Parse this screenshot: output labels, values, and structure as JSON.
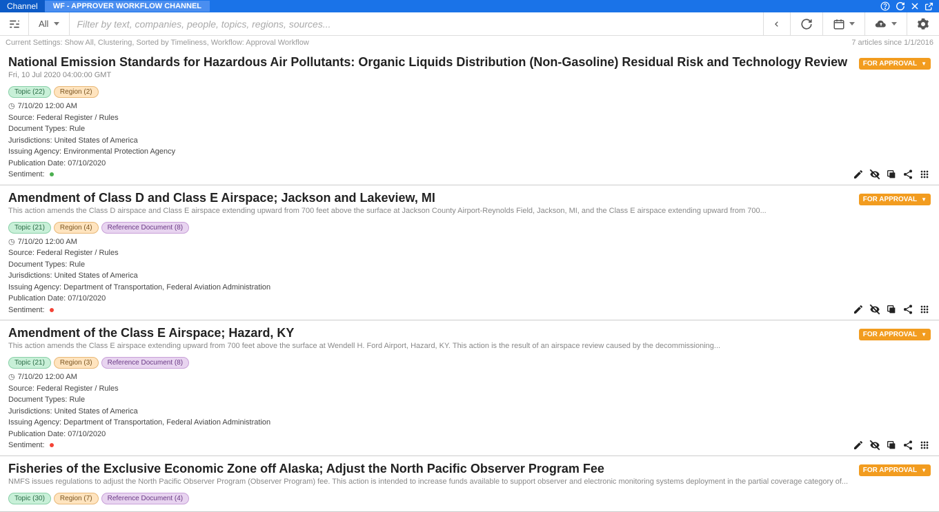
{
  "topbar": {
    "channel_label": "Channel",
    "channel_name": "WF - APPROVER WORKFLOW CHANNEL"
  },
  "filterbar": {
    "all_label": "All",
    "search_placeholder": "Filter by text, companies, people, topics, regions, sources..."
  },
  "settings_left": "Current Settings: Show All, Clustering, Sorted by Timeliness, Workflow: Approval Workflow",
  "settings_right": "7 articles since 1/1/2016",
  "approval_label": "FOR APPROVAL",
  "articles": [
    {
      "title": "National Emission Standards for Hazardous Air Pollutants: Organic Liquids Distribution (Non-Gasoline) Residual Risk and Technology Review",
      "sub": "Fri, 10 Jul 2020 04:00:00 GMT",
      "badges": {
        "topic": "Topic (22)",
        "region": "Region (2)",
        "refdoc": ""
      },
      "time": "7/10/20 12:00 AM",
      "source": "Source: Federal Register / Rules",
      "doctype": "Document Types: Rule",
      "juris": "Jurisdictions: United States of America",
      "agency": "Issuing Agency: Environmental Protection Agency",
      "pubdate": "Publication Date: 07/10/2020",
      "sentiment_label": "Sentiment:",
      "sentiment": "green"
    },
    {
      "title": "Amendment of Class D and Class E Airspace; Jackson and Lakeview, MI",
      "sub": "This action amends the Class D airspace and Class E airspace extending upward from 700 feet above the surface at Jackson County Airport-Reynolds Field, Jackson, MI, and the Class E airspace extending upward from 700...",
      "badges": {
        "topic": "Topic (21)",
        "region": "Region (4)",
        "refdoc": "Reference Document (8)"
      },
      "time": "7/10/20 12:00 AM",
      "source": "Source: Federal Register / Rules",
      "doctype": "Document Types: Rule",
      "juris": "Jurisdictions: United States of America",
      "agency": "Issuing Agency: Department of Transportation, Federal Aviation Administration",
      "pubdate": "Publication Date: 07/10/2020",
      "sentiment_label": "Sentiment:",
      "sentiment": "red"
    },
    {
      "title": "Amendment of the Class E Airspace; Hazard, KY",
      "sub": "This action amends the Class E airspace extending upward from 700 feet above the surface at Wendell H. Ford Airport, Hazard, KY. This action is the result of an airspace review caused by the decommissioning...",
      "badges": {
        "topic": "Topic (21)",
        "region": "Region (3)",
        "refdoc": "Reference Document (8)"
      },
      "time": "7/10/20 12:00 AM",
      "source": "Source: Federal Register / Rules",
      "doctype": "Document Types: Rule",
      "juris": "Jurisdictions: United States of America",
      "agency": "Issuing Agency: Department of Transportation, Federal Aviation Administration",
      "pubdate": "Publication Date: 07/10/2020",
      "sentiment_label": "Sentiment:",
      "sentiment": "red"
    },
    {
      "title": "Fisheries of the Exclusive Economic Zone off Alaska; Adjust the North Pacific Observer Program Fee",
      "sub": "NMFS issues regulations to adjust the North Pacific Observer Program (Observer Program) fee. This action is intended to increase funds available to support observer and electronic monitoring systems deployment in the partial coverage category of...",
      "badges": {
        "topic": "Topic (30)",
        "region": "Region (7)",
        "refdoc": "Reference Document (4)"
      },
      "time": "",
      "source": "",
      "doctype": "",
      "juris": "",
      "agency": "",
      "pubdate": "",
      "sentiment_label": "",
      "sentiment": ""
    }
  ]
}
